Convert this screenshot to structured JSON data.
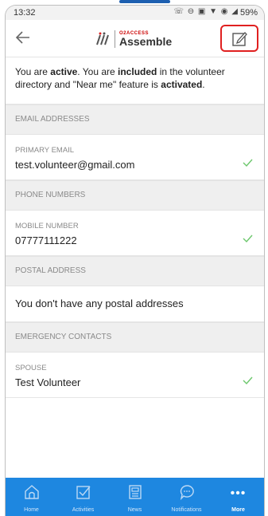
{
  "statusbar": {
    "time": "13:32",
    "icons_text": "☏ ⊖ ▣ ▼ ◉ ◢",
    "battery": "59%"
  },
  "appbar": {
    "logo_small": "O2ACCESS",
    "logo_big": "Assemble"
  },
  "banner": {
    "part1": "You are ",
    "active": "active",
    "part2": ". You are ",
    "included": "included",
    "part3": " in the volunteer directory and \"Near me\" feature is ",
    "activated": "activated",
    "part4": "."
  },
  "sections": {
    "email_header": "EMAIL ADDRESSES",
    "email_label": "PRIMARY EMAIL",
    "email_value": "test.volunteer@gmail.com",
    "phone_header": "PHONE NUMBERS",
    "phone_label": "MOBILE NUMBER",
    "phone_value": "07777111222",
    "postal_header": "POSTAL ADDRESS",
    "postal_value": "You don't have any postal addresses",
    "emergency_header": "EMERGENCY CONTACTS",
    "emergency_label": "SPOUSE",
    "emergency_value": "Test Volunteer"
  },
  "tabs": [
    {
      "label": "Home",
      "icon": "home-icon"
    },
    {
      "label": "Activities",
      "icon": "checkbox-icon"
    },
    {
      "label": "News",
      "icon": "newspaper-icon"
    },
    {
      "label": "Notifications",
      "icon": "chat-bubble-icon"
    },
    {
      "label": "More",
      "icon": "more-dots-icon"
    }
  ],
  "colors": {
    "tabbar": "#1e87e0",
    "check": "#6cc76c",
    "highlight": "#e02020"
  }
}
